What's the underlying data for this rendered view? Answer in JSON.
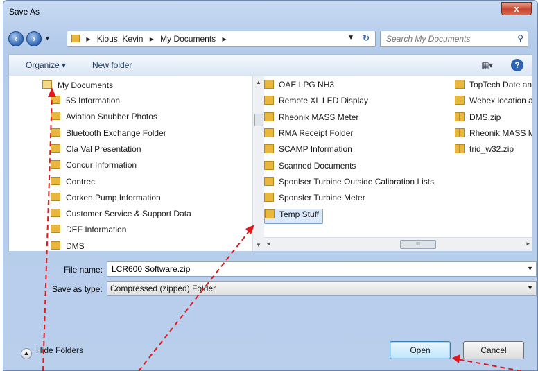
{
  "window": {
    "title": "Save As",
    "close_glyph": "x"
  },
  "nav": {
    "back_icon": "back-arrow-icon",
    "forward_icon": "forward-arrow-icon",
    "breadcrumbs": [
      "Kious, Kevin",
      "My Documents"
    ],
    "search_placeholder": "Search My Documents"
  },
  "toolbar": {
    "organize": "Organize ▾",
    "new_folder": "New folder"
  },
  "tree": {
    "root": "My Documents",
    "items": [
      "5S Information",
      "Aviation Snubber Photos",
      "Bluetooth Exchange Folder",
      "Cla Val Presentation",
      "Concur Information",
      "Contrec",
      "Corken Pump Information",
      "Customer Service & Support Data",
      "DEF Information",
      "DMS"
    ]
  },
  "files": {
    "col1": [
      {
        "name": "OAE LPG NH3",
        "type": "folder"
      },
      {
        "name": "Remote XL LED Display",
        "type": "folder"
      },
      {
        "name": "Rheonik MASS Meter",
        "type": "folder"
      },
      {
        "name": "RMA Receipt Folder",
        "type": "folder"
      },
      {
        "name": "SCAMP Information",
        "type": "folder"
      },
      {
        "name": "Scanned Documents",
        "type": "folder"
      },
      {
        "name": "Sponlser Turbine Outside Calibration Lists",
        "type": "folder"
      },
      {
        "name": "Sponsler Turbine Meter",
        "type": "folder"
      },
      {
        "name": "Temp Stuff",
        "type": "folder",
        "selected": true
      }
    ],
    "col2": [
      {
        "name": "TopTech Date and",
        "type": "folder"
      },
      {
        "name": "Webex location an",
        "type": "folder"
      },
      {
        "name": "DMS.zip",
        "type": "zip"
      },
      {
        "name": "Rheonik MASS Me",
        "type": "zip"
      },
      {
        "name": "trid_w32.zip",
        "type": "zip"
      }
    ],
    "scroll_grip": "III"
  },
  "form": {
    "filename_label": "File name:",
    "filename_value": "LCR600 Software.zip",
    "savetype_label": "Save as type:",
    "savetype_value": "Compressed (zipped) Folder"
  },
  "footer": {
    "hide_folders": "Hide Folders",
    "open": "Open",
    "cancel": "Cancel"
  },
  "colors": {
    "annotation_arrow": "#e0191b",
    "selection": "#d9e9fb",
    "folder": "#e9b73d"
  }
}
